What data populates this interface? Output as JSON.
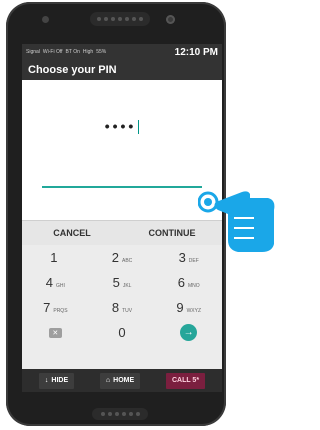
{
  "status_bar": {
    "signal": "Signal",
    "wifi": "Wi-Fi Off",
    "bt": "BT On",
    "volume": "High",
    "battery": "55%",
    "time": "12:10 PM"
  },
  "title": "Choose your PIN",
  "pin": {
    "masked": "••••"
  },
  "actions": {
    "cancel": "CANCEL",
    "continue": "CONTINUE"
  },
  "keypad": {
    "rows": [
      [
        {
          "digit": "1",
          "letters": ""
        },
        {
          "digit": "2",
          "letters": "ABC"
        },
        {
          "digit": "3",
          "letters": "DEF"
        }
      ],
      [
        {
          "digit": "4",
          "letters": "GHI"
        },
        {
          "digit": "5",
          "letters": "JKL"
        },
        {
          "digit": "6",
          "letters": "MNO"
        }
      ],
      [
        {
          "digit": "7",
          "letters": "PRQS"
        },
        {
          "digit": "8",
          "letters": "TUV"
        },
        {
          "digit": "9",
          "letters": "WXYZ"
        }
      ],
      [
        {
          "digit": "0",
          "letters": ""
        }
      ]
    ]
  },
  "bottom_bar": {
    "hide": "HIDE",
    "home": "HOME",
    "call": "CALL 5*"
  },
  "colors": {
    "accent": "#26a69a",
    "hand": "#1aa7e8",
    "call_bg": "#7b1f3f"
  },
  "icons": {
    "hand": "pointing-hand-icon",
    "backspace": "backspace-icon",
    "enter": "enter-arrow-icon"
  }
}
